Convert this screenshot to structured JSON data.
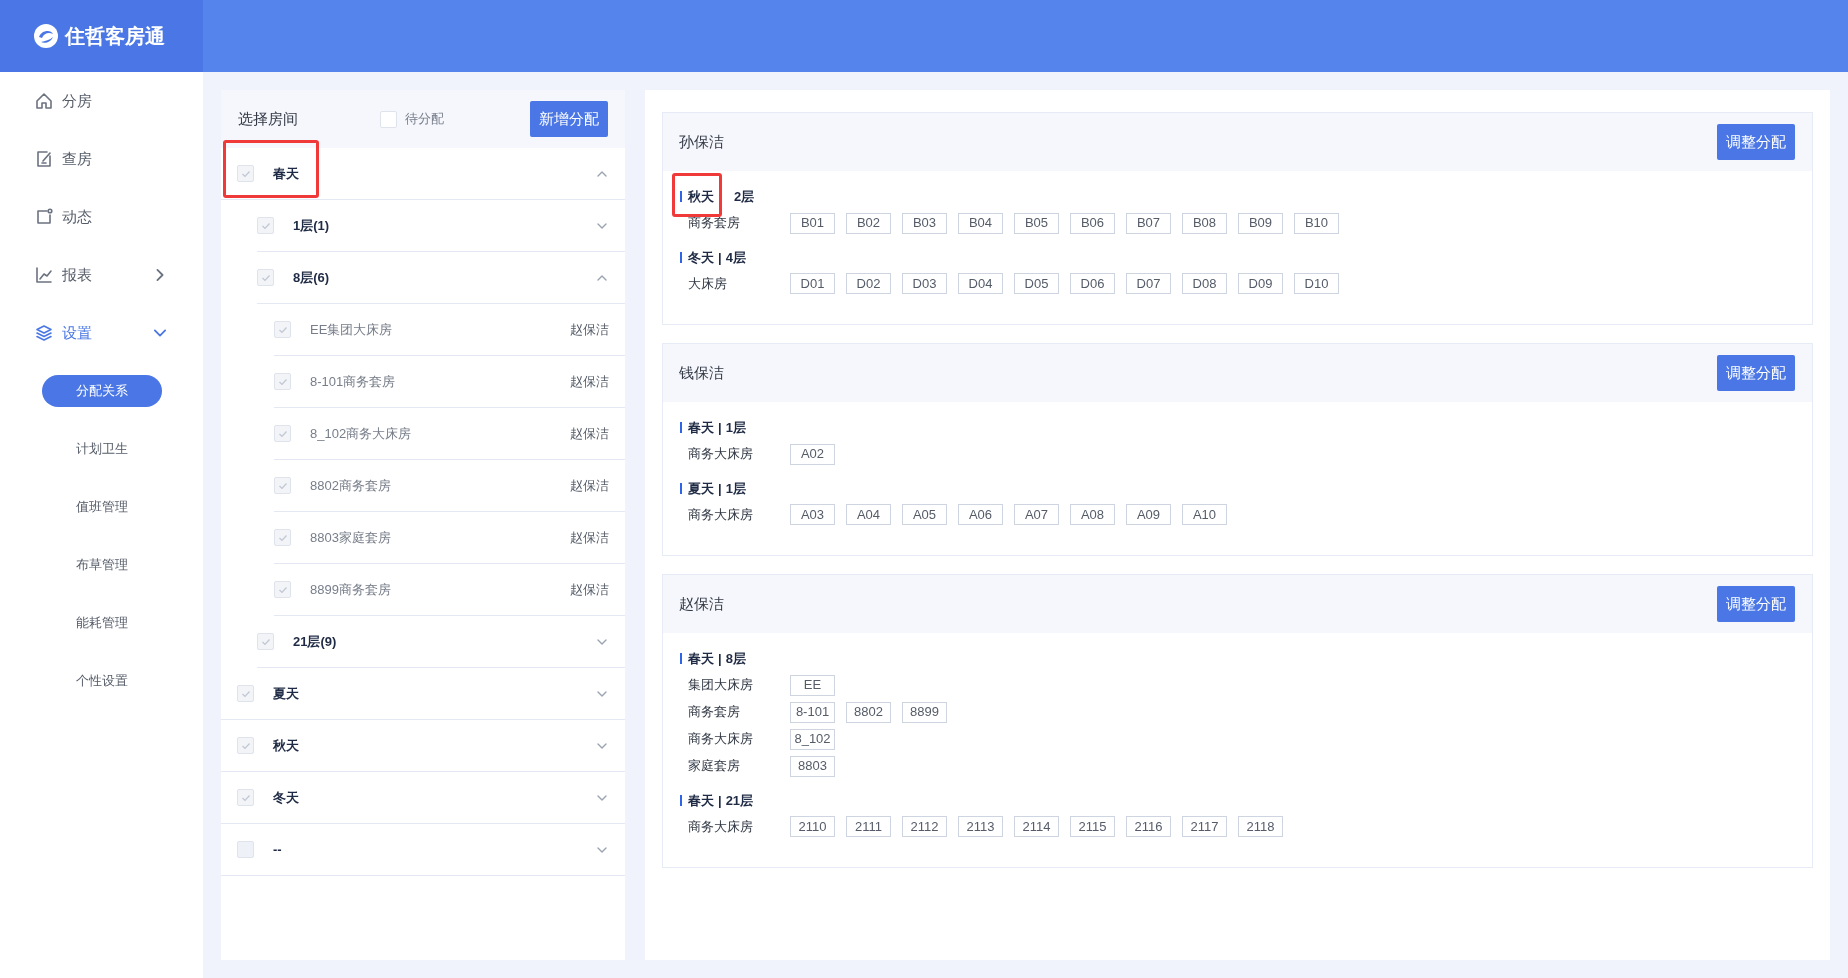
{
  "brand": {
    "name": "住哲客房通"
  },
  "sidebar": {
    "items": [
      {
        "label": "分房",
        "active": false
      },
      {
        "label": "查房",
        "active": false
      },
      {
        "label": "动态",
        "active": false
      },
      {
        "label": "报表",
        "expanded": false,
        "active": false
      },
      {
        "label": "设置",
        "expanded": true,
        "active": true,
        "children": [
          {
            "label": "分配关系",
            "selected": true
          },
          {
            "label": "计划卫生",
            "selected": false
          },
          {
            "label": "值班管理",
            "selected": false
          },
          {
            "label": "布草管理",
            "selected": false
          },
          {
            "label": "能耗管理",
            "selected": false
          },
          {
            "label": "个性设置",
            "selected": false
          }
        ]
      }
    ]
  },
  "room_panel": {
    "title": "选择房间",
    "pending_filter": {
      "label": "待分配",
      "checked": false
    },
    "add_button": "新增分配",
    "tree": [
      {
        "label": "春天",
        "checked": true,
        "expanded": true,
        "highlighted": true,
        "children": [
          {
            "label": "1层(1)",
            "checked": true,
            "expanded": false
          },
          {
            "label": "8层(6)",
            "checked": true,
            "expanded": true,
            "children": [
              {
                "label": "EE集团大床房",
                "checked": true,
                "assignee": "赵保洁"
              },
              {
                "label": "8-101商务套房",
                "checked": true,
                "assignee": "赵保洁"
              },
              {
                "label": "8_102商务大床房",
                "checked": true,
                "assignee": "赵保洁"
              },
              {
                "label": "8802商务套房",
                "checked": true,
                "assignee": "赵保洁"
              },
              {
                "label": "8803家庭套房",
                "checked": true,
                "assignee": "赵保洁"
              },
              {
                "label": "8899商务套房",
                "checked": true,
                "assignee": "赵保洁"
              }
            ]
          },
          {
            "label": "21层(9)",
            "checked": true,
            "expanded": false
          }
        ]
      },
      {
        "label": "夏天",
        "checked": true,
        "expanded": false
      },
      {
        "label": "秋天",
        "checked": true,
        "expanded": false
      },
      {
        "label": "冬天",
        "checked": true,
        "expanded": false
      },
      {
        "label": "--",
        "checked": false,
        "expanded": false
      }
    ]
  },
  "cleaners": [
    {
      "name": "孙保洁",
      "button": "调整分配",
      "groups": [
        {
          "area": "秋天",
          "floor": "2层",
          "highlighted": true,
          "rows": [
            {
              "type": "商务套房",
              "rooms": [
                "B01",
                "B02",
                "B03",
                "B04",
                "B05",
                "B06",
                "B07",
                "B08",
                "B09",
                "B10"
              ]
            }
          ]
        },
        {
          "area": "冬天",
          "separator": "|",
          "floor": "4层",
          "rows": [
            {
              "type": "大床房",
              "rooms": [
                "D01",
                "D02",
                "D03",
                "D04",
                "D05",
                "D06",
                "D07",
                "D08",
                "D09",
                "D10"
              ]
            }
          ]
        }
      ]
    },
    {
      "name": "钱保洁",
      "button": "调整分配",
      "groups": [
        {
          "area": "春天",
          "separator": "|",
          "floor": "1层",
          "rows": [
            {
              "type": "商务大床房",
              "rooms": [
                "A02"
              ]
            }
          ]
        },
        {
          "area": "夏天",
          "separator": "|",
          "floor": "1层",
          "rows": [
            {
              "type": "商务大床房",
              "rooms": [
                "A03",
                "A04",
                "A05",
                "A06",
                "A07",
                "A08",
                "A09",
                "A10"
              ]
            }
          ]
        }
      ]
    },
    {
      "name": "赵保洁",
      "button": "调整分配",
      "groups": [
        {
          "area": "春天",
          "separator": "|",
          "floor": "8层",
          "rows": [
            {
              "type": "集团大床房",
              "rooms": [
                "EE"
              ]
            },
            {
              "type": "商务套房",
              "rooms": [
                "8-101",
                "8802",
                "8899"
              ]
            },
            {
              "type": "商务大床房",
              "rooms": [
                "8_102"
              ]
            },
            {
              "type": "家庭套房",
              "rooms": [
                "8803"
              ]
            }
          ]
        },
        {
          "area": "春天",
          "separator": "|",
          "floor": "21层",
          "rows": [
            {
              "type": "商务大床房",
              "rooms": [
                "2110",
                "2111",
                "2112",
                "2113",
                "2114",
                "2115",
                "2116",
                "2117",
                "2118"
              ]
            }
          ]
        }
      ]
    }
  ]
}
